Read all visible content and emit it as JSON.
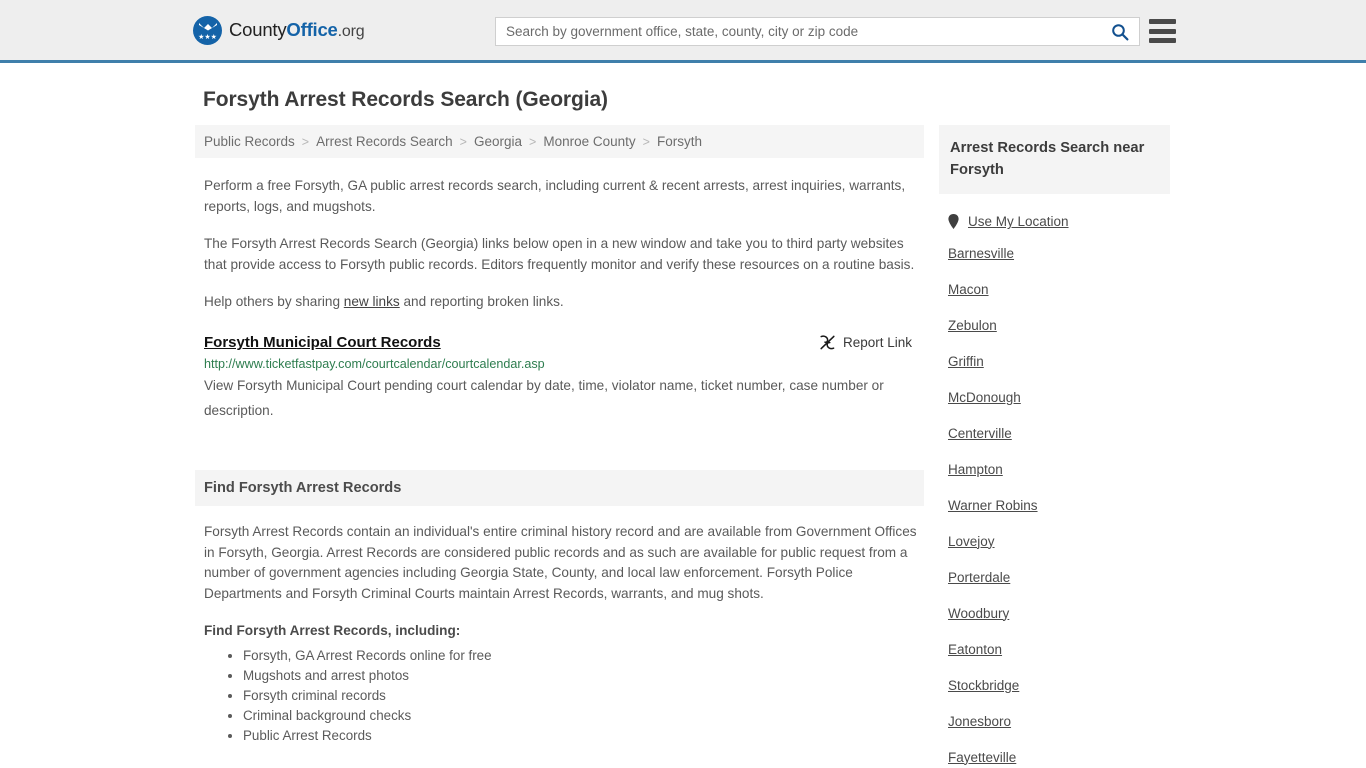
{
  "header": {
    "logo": {
      "text_part1": "County",
      "text_part2": "Office",
      "text_part3": ".org",
      "icon": "eagle-seal-icon"
    },
    "search": {
      "placeholder": "Search by government office, state, county, city or zip code",
      "value": "",
      "button_icon": "search-icon"
    },
    "menu_icon": "hamburger-menu-icon"
  },
  "page": {
    "title": "Forsyth Arrest Records Search (Georgia)"
  },
  "breadcrumb": {
    "separator": ">",
    "items": [
      {
        "label": "Public Records"
      },
      {
        "label": "Arrest Records Search"
      },
      {
        "label": "Georgia"
      },
      {
        "label": "Monroe County"
      },
      {
        "label": "Forsyth"
      }
    ]
  },
  "intro": {
    "paragraph1": "Perform a free Forsyth, GA public arrest records search, including current & recent arrests, arrest inquiries, warrants, reports, logs, and mugshots.",
    "paragraph2": "The Forsyth Arrest Records Search (Georgia) links below open in a new window and take you to third party websites that provide access to Forsyth public records. Editors frequently monitor and verify these resources on a routine basis.",
    "paragraph3_before": "Help others by sharing ",
    "paragraph3_link": "new links",
    "paragraph3_after": " and reporting broken links."
  },
  "result": {
    "title": "Forsyth Municipal Court Records",
    "url": "http://www.ticketfastpay.com/courtcalendar/courtcalendar.asp",
    "description": "View Forsyth Municipal Court pending court calendar by date, time, violator name, ticket number, case number or description.",
    "report": {
      "label": "Report Link",
      "icon": "broken-link-icon"
    }
  },
  "find_section": {
    "heading": "Find Forsyth Arrest Records",
    "body": "Forsyth Arrest Records contain an individual's entire criminal history record and are available from Government Offices in Forsyth, Georgia. Arrest Records are considered public records and as such are available for public request from a number of government agencies including Georgia State, County, and local law enforcement. Forsyth Police Departments and Forsyth Criminal Courts maintain Arrest Records, warrants, and mug shots.",
    "sub_heading": "Find Forsyth Arrest Records, including:",
    "bullets": [
      "Forsyth, GA Arrest Records online for free",
      "Mugshots and arrest photos",
      "Forsyth criminal records",
      "Criminal background checks",
      "Public Arrest Records"
    ]
  },
  "sidebar": {
    "heading": "Arrest Records Search near Forsyth",
    "use_my_location": {
      "label": "Use My Location",
      "icon": "map-pin-icon"
    },
    "locations": [
      {
        "label": "Barnesville"
      },
      {
        "label": "Macon"
      },
      {
        "label": "Zebulon"
      },
      {
        "label": "Griffin"
      },
      {
        "label": "McDonough"
      },
      {
        "label": "Centerville"
      },
      {
        "label": "Hampton"
      },
      {
        "label": "Warner Robins"
      },
      {
        "label": "Lovejoy"
      },
      {
        "label": "Porterdale"
      },
      {
        "label": "Woodbury"
      },
      {
        "label": "Eatonton"
      },
      {
        "label": "Stockbridge"
      },
      {
        "label": "Jonesboro"
      },
      {
        "label": "Fayetteville"
      }
    ]
  },
  "colors": {
    "brand_blue": "#1463a8",
    "header_border": "#3f7fab",
    "url_green": "#2e7d4f",
    "header_bg": "#eeeeee",
    "panel_bg": "#f4f4f4"
  }
}
